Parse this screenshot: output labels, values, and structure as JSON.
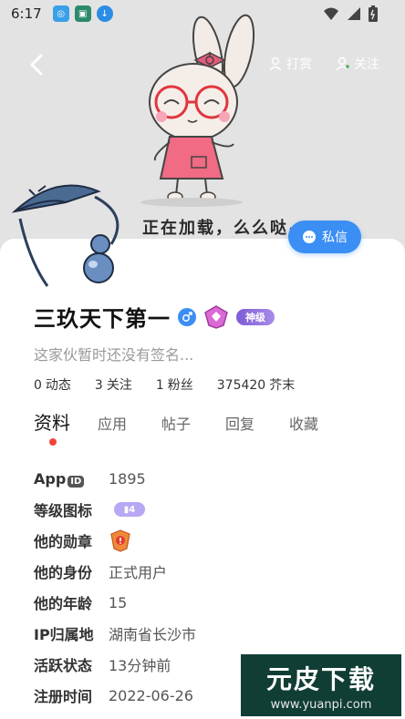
{
  "status_bar": {
    "time": "6:17"
  },
  "header": {
    "reward_label": "打赏",
    "follow_label": "关注",
    "banner_caption": "正在加载，么么哒~",
    "pm_label": "私信"
  },
  "profile": {
    "username": "三玖天下第一",
    "title_badge": "神级",
    "signature": "这家伙暂时还没有签名...",
    "stats": [
      {
        "value": "0",
        "label": "动态"
      },
      {
        "value": "3",
        "label": "关注"
      },
      {
        "value": "1",
        "label": "粉丝"
      },
      {
        "value": "375420",
        "label": "芥末"
      }
    ]
  },
  "tabs": [
    "资料",
    "应用",
    "帖子",
    "回复",
    "收藏"
  ],
  "info": {
    "app_label": "App",
    "app_id_chip": "ID",
    "app_id": "1895",
    "level_label": "等级图标",
    "level_value": "4",
    "medal_label": "他的勋章",
    "identity_label": "他的身份",
    "identity_value": "正式用户",
    "age_label": "他的年龄",
    "age_value": "15",
    "ip_label": "IP归属地",
    "ip_value": "湖南省长沙市",
    "active_label": "活跃状态",
    "active_value": "13分钟前",
    "reg_label": "注册时间",
    "reg_value": "2022-06-26"
  },
  "watermark": {
    "big": "元皮下载",
    "small": "www.yuanpi.com"
  },
  "colors": {
    "accent": "#3a8ef4",
    "dot": "#f2443b",
    "watermark_bg": "#103e35"
  }
}
